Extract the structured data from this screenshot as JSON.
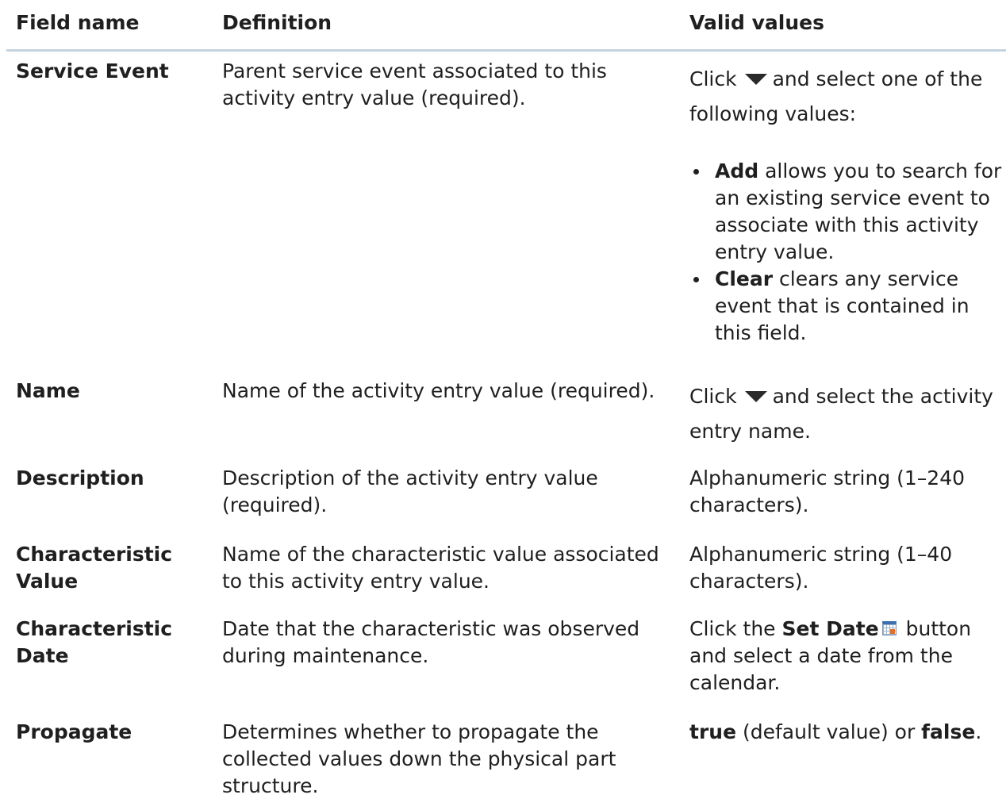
{
  "headers": {
    "field": "Field name",
    "definition": "Definition",
    "valid": "Valid values"
  },
  "rows": [
    {
      "field": "Service Event",
      "definition": "Parent service event associated to this activity entry value (required).",
      "valid": {
        "before_icon": "Click",
        "icon": "dropdown-arrow-icon",
        "after_icon": "and select one of the following values:",
        "bullets": [
          {
            "bold": "Add",
            "text": " allows you to search for an existing service event to associate with this activity entry value."
          },
          {
            "bold": "Clear",
            "text": " clears any service event that is contained in this field."
          }
        ]
      }
    },
    {
      "field": "Name",
      "definition": "Name of the activity entry value (required).",
      "valid": {
        "before_icon": "Click",
        "icon": "dropdown-arrow-icon",
        "after_icon": "and select the activity entry name."
      }
    },
    {
      "field": "Description",
      "definition": "Description of the activity entry value (required).",
      "valid": {
        "text": "Alphanumeric string (1–240 characters)."
      }
    },
    {
      "field": "Characteristic Value",
      "definition": "Name of the characteristic value associated to this activity entry value.",
      "valid": {
        "text": "Alphanumeric string (1–40 characters)."
      }
    },
    {
      "field": "Characteristic Date",
      "definition": "Date that the characteristic was observed during maintenance.",
      "valid": {
        "before": "Click the ",
        "bold": "Set Date",
        "icon": "calendar-icon",
        "after": " button and select a date from the calendar."
      }
    },
    {
      "field": "Propagate",
      "definition": "Determines whether to propagate the collected values down the physical part structure.",
      "valid": {
        "bold1": "true",
        "middle": " (default value) or ",
        "bold2": "false",
        "end": "."
      }
    }
  ]
}
